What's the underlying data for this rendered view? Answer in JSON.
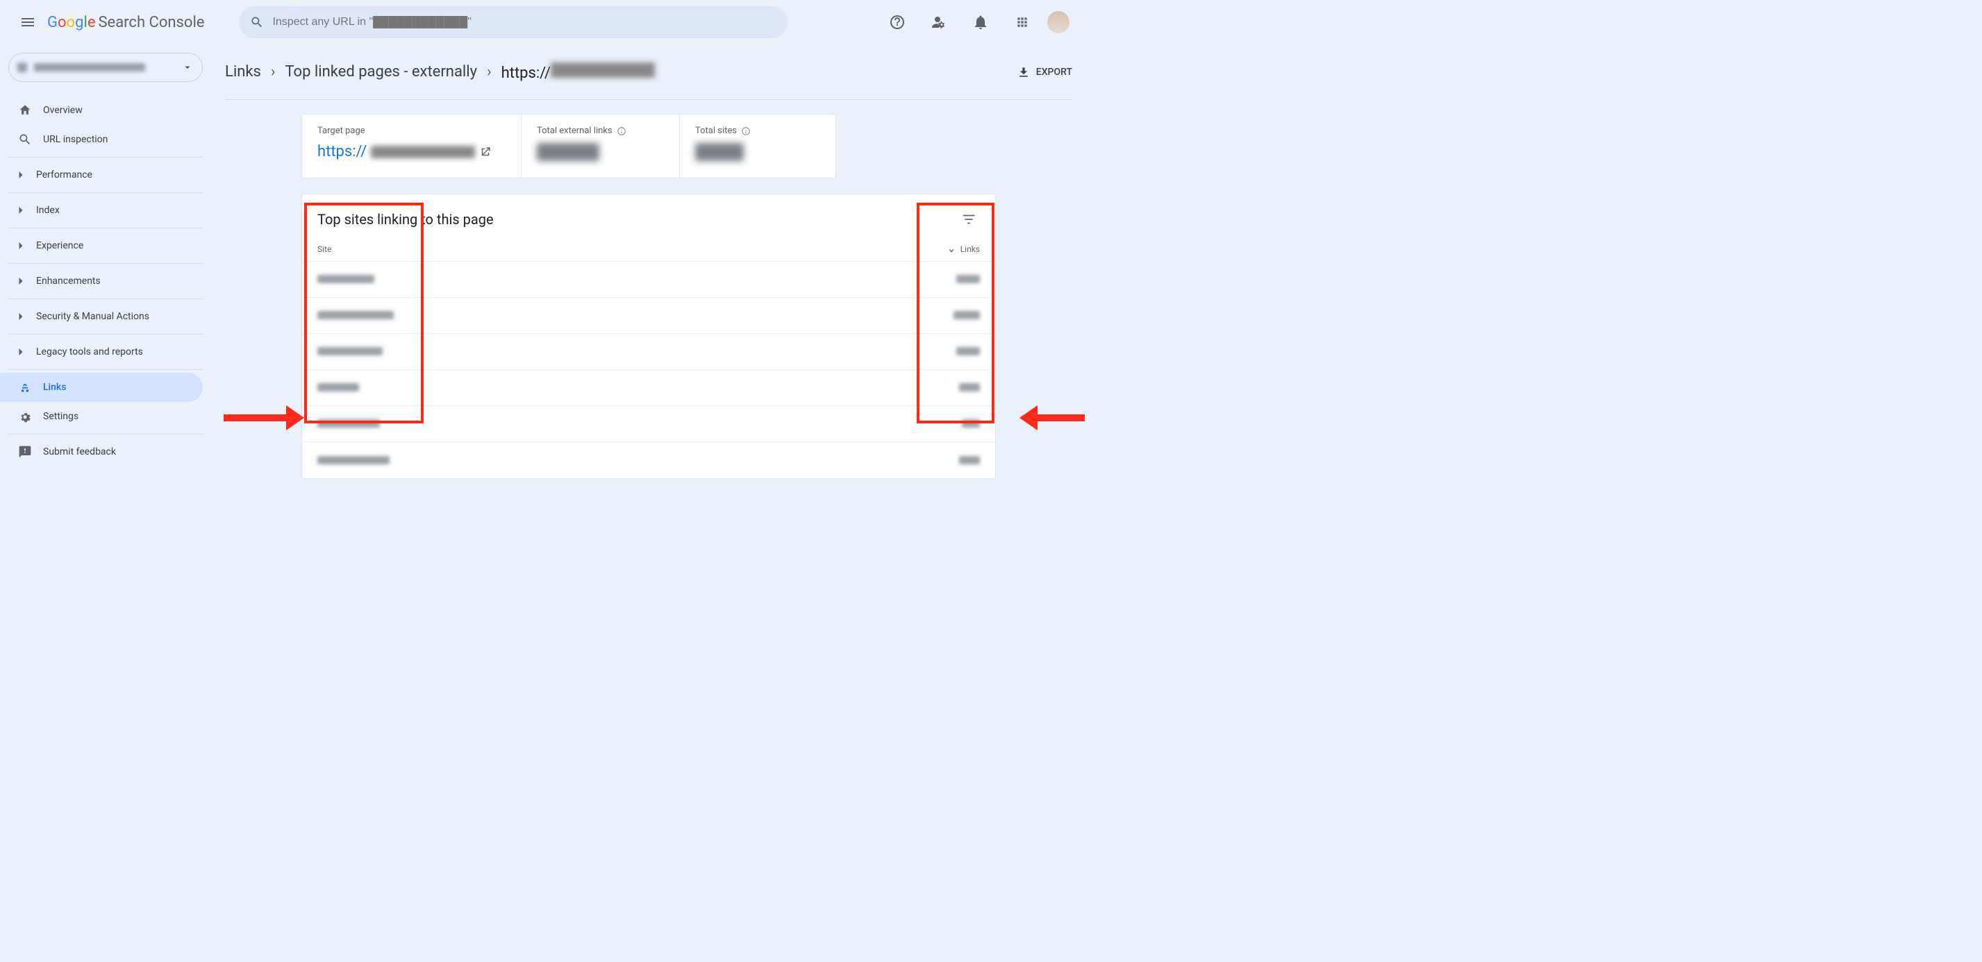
{
  "app": {
    "product_name": "Search Console"
  },
  "search": {
    "placeholder": "Inspect any URL in \"████████████\""
  },
  "sidebar": {
    "items": [
      {
        "label": "Overview",
        "icon": "home"
      },
      {
        "label": "URL inspection",
        "icon": "search"
      }
    ],
    "sections": [
      {
        "label": "Performance"
      },
      {
        "label": "Index"
      },
      {
        "label": "Experience"
      },
      {
        "label": "Enhancements"
      },
      {
        "label": "Security & Manual Actions"
      },
      {
        "label": "Legacy tools and reports"
      }
    ],
    "links_label": "Links",
    "settings_label": "Settings",
    "feedback_label": "Submit feedback"
  },
  "breadcrumb": {
    "root": "Links",
    "level2": "Top linked pages - externally",
    "level3": "https://"
  },
  "export_label": "EXPORT",
  "cards": {
    "target": {
      "label": "Target page",
      "url": "https://"
    },
    "external_links": {
      "label": "Total external links"
    },
    "total_sites": {
      "label": "Total sites"
    }
  },
  "table": {
    "title": "Top sites linking to this page",
    "col_site": "Site",
    "col_links": "Links",
    "rows": [
      {
        "site_w": 82,
        "links_w": 34
      },
      {
        "site_w": 110,
        "links_w": 38
      },
      {
        "site_w": 94,
        "links_w": 34
      },
      {
        "site_w": 60,
        "links_w": 30
      },
      {
        "site_w": 90,
        "links_w": 26
      },
      {
        "site_w": 104,
        "links_w": 30
      }
    ]
  }
}
